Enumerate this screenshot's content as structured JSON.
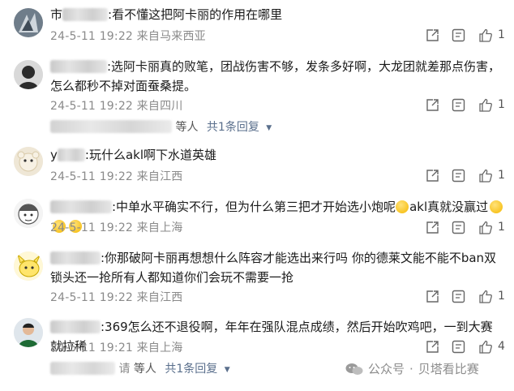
{
  "comments": [
    {
      "name_visible": "市",
      "text": ":看不懂这把阿卡丽的作用在哪里",
      "meta": "24-5-11 19:22 来自马来西亚",
      "likes": "1"
    },
    {
      "name_visible": "",
      "text": ":选阿卡丽真的败笔，团战伤害不够，发条多好啊，大龙团就差那点伤害，怎么都秒不掉对面蚕桑提。",
      "meta": "24-5-11 19:22 来自四川",
      "likes": "1",
      "replies": {
        "suffix": "等人",
        "link": "共",
        "count": "1",
        "link_tail": "条回复"
      }
    },
    {
      "name_visible": "y",
      "text": ":玩什么akl啊下水道英雄",
      "meta": "24-5-11 19:22 来自江西",
      "likes": "1"
    },
    {
      "name_visible": "",
      "text": ":中单水平确实不行，但为什么第三把才开始选小炮呢",
      "text_b": "akl真就没赢过",
      "meta": "24-5-11 19:22 来自上海",
      "likes": "1"
    },
    {
      "name_visible": "",
      "text": ":你那破阿卡丽再想想什么阵容才能选出来行吗 你的德莱文能不能不ban双锁头还一抢所有人都知道你们会玩不需要一抢",
      "meta": "24-5-11 19:22 来自江西",
      "likes": "1"
    },
    {
      "name_visible": "",
      "text": ":369怎么还不退役啊，年年在强队混点成绩，然后开始吹鸡吧，一到大赛就拉稀",
      "meta": "24-5-11 19:21 来自上海",
      "likes": "4",
      "replies": {
        "name_tail": "请",
        "suffix": "等人",
        "link": "共",
        "count": "1",
        "link_tail": "条回复"
      }
    }
  ],
  "watermark": {
    "label": "公众号",
    "separator": "·",
    "name": "贝塔看比赛"
  },
  "colors": {
    "link": "#5a6f8c",
    "meta": "#8a8a8a"
  }
}
